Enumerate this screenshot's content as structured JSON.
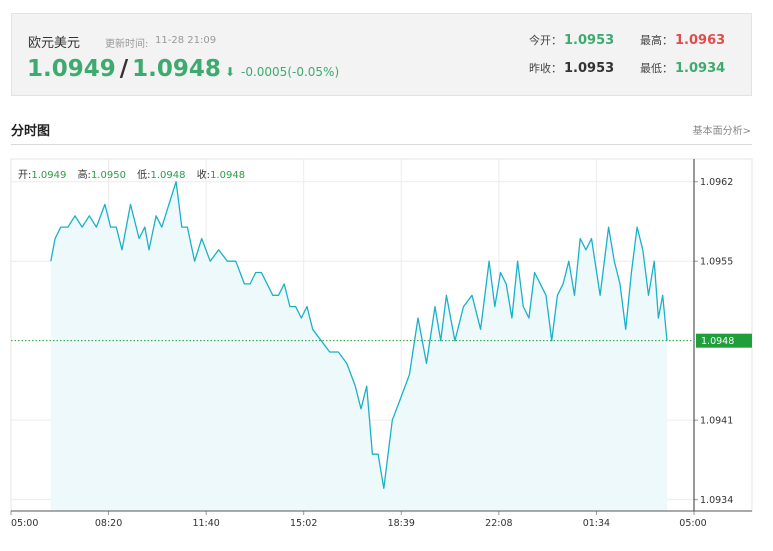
{
  "quote": {
    "pair_name": "欧元美元",
    "update_label": "更新时间:",
    "update_time": "11-28 21:09",
    "bid": "1.0949",
    "separator": "/",
    "ask": "1.0948",
    "direction_icon": "down-arrow-icon",
    "change": "-0.0005(-0.05%)",
    "open_label": "今开：",
    "open_value": "1.0953",
    "high_label": "最高：",
    "high_value": "1.0963",
    "prev_close_label": "昨收：",
    "prev_close_value": "1.0953",
    "low_label": "最低：",
    "low_value": "1.0934"
  },
  "section": {
    "title": "分时图",
    "link": "基本面分析>"
  },
  "ohlc": {
    "open_label": "开:",
    "open_value": "1.0949",
    "high_label": "高:",
    "high_value": "1.0950",
    "low_label": "低:",
    "low_value": "1.0948",
    "close_label": "收:",
    "close_value": "1.0948"
  },
  "colors": {
    "up": "#3daa6f",
    "high": "#e04b4b",
    "line": "#1ab1c8",
    "area": "#eef9fc",
    "last_tag": "#1f9e3a"
  },
  "chart_data": {
    "type": "area",
    "x_axis": {
      "ticks": [
        "05:00",
        "08:20",
        "11:40",
        "15:02",
        "18:39",
        "22:08",
        "01:34",
        "05:00"
      ]
    },
    "y_axis": {
      "range": [
        1.0933,
        1.0964
      ],
      "ticks": [
        "1.0962",
        "1.0955",
        "1.0948",
        "1.0941",
        "1.0934"
      ],
      "side": "right"
    },
    "last_price": {
      "value": 1.0948,
      "label": "1.0948"
    },
    "series": [
      {
        "x_hours_from_start": [
          1.4,
          1.55,
          1.75,
          2.0,
          2.25,
          2.5,
          2.75,
          3.0,
          3.3,
          3.5,
          3.7,
          3.9,
          4.2,
          4.5,
          4.7,
          4.85,
          5.1,
          5.3,
          5.55,
          5.8,
          6.0,
          6.2,
          6.45,
          6.7,
          7.0,
          7.3,
          7.6,
          7.9,
          8.2,
          8.4,
          8.6,
          8.8,
          9.0,
          9.2,
          9.4,
          9.6,
          9.8,
          10.0,
          10.2,
          10.4,
          10.6,
          10.9,
          11.2,
          11.5,
          11.8,
          12.1,
          12.3,
          12.5,
          12.7,
          12.9,
          13.1,
          13.4,
          13.7,
          14.0,
          14.3,
          14.6,
          14.9,
          15.1,
          15.3,
          15.6,
          15.9,
          16.2,
          16.5,
          16.8,
          17.0,
          17.2,
          17.4,
          17.6,
          17.8,
          18.0,
          18.2,
          18.4,
          18.6,
          18.8,
          19.0,
          19.2,
          19.4,
          19.6,
          19.8,
          20.0,
          20.2,
          20.4,
          20.7,
          21.0,
          21.2,
          21.4,
          21.6,
          21.8,
          22.0,
          22.2,
          22.4,
          22.6,
          22.75,
          22.9,
          23.05
        ],
        "values": [
          1.0955,
          1.0957,
          1.0958,
          1.0958,
          1.0959,
          1.0958,
          1.0959,
          1.0958,
          1.096,
          1.0958,
          1.0958,
          1.0956,
          1.096,
          1.0957,
          1.0958,
          1.0956,
          1.0959,
          1.0958,
          1.096,
          1.0962,
          1.0958,
          1.0958,
          1.0955,
          1.0957,
          1.0955,
          1.0956,
          1.0955,
          1.0955,
          1.0953,
          1.0953,
          1.0954,
          1.0954,
          1.0953,
          1.0952,
          1.0952,
          1.0953,
          1.0951,
          1.0951,
          1.095,
          1.0951,
          1.0949,
          1.0948,
          1.0947,
          1.0947,
          1.0946,
          1.0944,
          1.0942,
          1.0944,
          1.0938,
          1.0938,
          1.0935,
          1.0941,
          1.0943,
          1.0945,
          1.095,
          1.0946,
          1.0951,
          1.0948,
          1.0952,
          1.0948,
          1.0951,
          1.0952,
          1.0949,
          1.0955,
          1.0951,
          1.0954,
          1.0953,
          1.095,
          1.0955,
          1.0951,
          1.095,
          1.0954,
          1.0953,
          1.0952,
          1.0948,
          1.0952,
          1.0953,
          1.0955,
          1.0952,
          1.0957,
          1.0956,
          1.0957,
          1.0952,
          1.0958,
          1.0955,
          1.0953,
          1.0949,
          1.0954,
          1.0958,
          1.0956,
          1.0952,
          1.0955,
          1.095,
          1.0952,
          1.0948
        ]
      }
    ]
  }
}
